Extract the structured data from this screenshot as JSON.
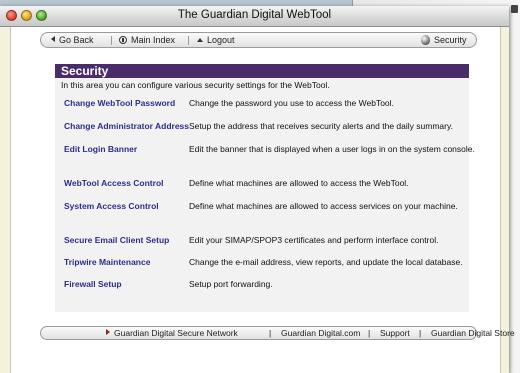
{
  "window": {
    "title": "The Guardian Digital WebTool"
  },
  "navbar": {
    "back_label": "Go Back",
    "main_label": "Main Index",
    "logout_label": "Logout",
    "section_label": "Security"
  },
  "security": {
    "heading": "Security",
    "intro": "In this area you can configure various security settings for the WebTool.",
    "items": [
      {
        "link": "Change WebTool Password",
        "desc": "Change the password you use to access the WebTool."
      },
      {
        "link": "Change Administrator Address",
        "desc": "Setup the address that receives security alerts and the daily summary."
      },
      {
        "link": "Edit Login Banner",
        "desc": "Edit the banner that is displayed when a user logs in on the system console."
      },
      {
        "link": "WebTool Access Control",
        "desc": "Define what machines are allowed to access the WebTool."
      },
      {
        "link": "System Access Control",
        "desc": "Define what machines are allowed to access services on your machine."
      },
      {
        "link": "Secure Email Client Setup",
        "desc": "Edit your SIMAP/SPOP3 certificates and perform interface control."
      },
      {
        "link": "Tripwire Maintenance",
        "desc": "Change the e-mail address, view reports, and update the local database."
      },
      {
        "link": "Firewall Setup",
        "desc": "Setup port forwarding."
      }
    ]
  },
  "footer": {
    "links": [
      "Guardian Digital Secure Network",
      "Guardian Digital.com",
      "Support",
      "Guardian Digital Store"
    ],
    "separator": "|"
  },
  "colors": {
    "header_bg": "#4b2c6a",
    "link": "#2d2d8f",
    "page_bg": "#f4f1dc"
  }
}
